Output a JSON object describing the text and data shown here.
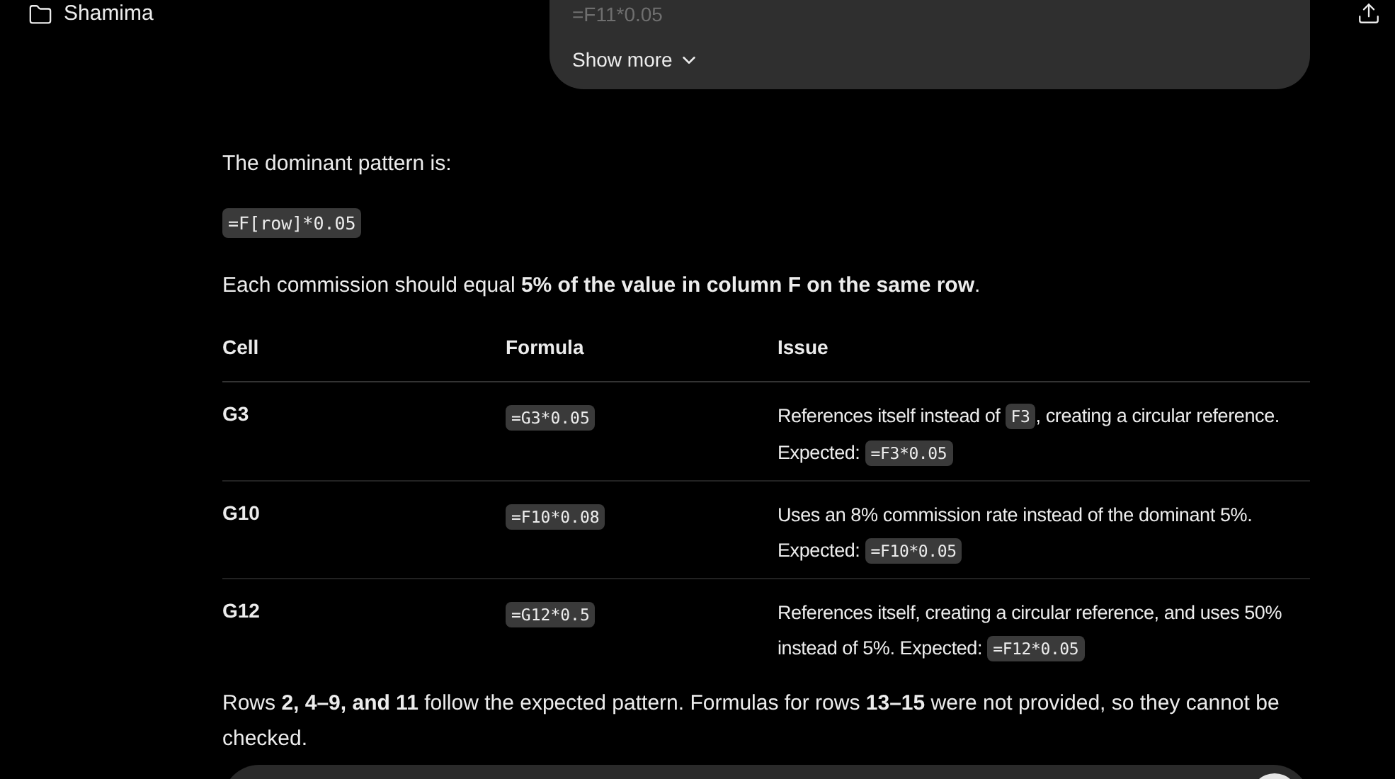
{
  "sidebar": {
    "project": "Shamima"
  },
  "user_message": {
    "preview": "=F11*0.05",
    "toggle": "Show more"
  },
  "answer": {
    "intro": "The dominant pattern is:",
    "pattern": "=F[row]*0.05",
    "explanation": "Each commission should equal **5% of the value in column F on the same row**.",
    "table": {
      "columns": [
        "Cell",
        "Formula",
        "Issue"
      ],
      "rows": [
        {
          "cell": "G3",
          "formula": "=G3*0.05",
          "issue": [
            {
              "kind": "text",
              "text": "References itself instead of "
            },
            {
              "kind": "code",
              "text": "F3"
            },
            {
              "kind": "text",
              "text": ", creating a circular reference."
            },
            {
              "kind": "break"
            },
            {
              "kind": "text",
              "text": "Expected: "
            },
            {
              "kind": "code",
              "text": "=F3*0.05"
            }
          ]
        },
        {
          "cell": "G10",
          "formula": "=F10*0.08",
          "issue": [
            {
              "kind": "text",
              "text": "Uses an 8% commission rate instead of the dominant 5%."
            },
            {
              "kind": "break"
            },
            {
              "kind": "text",
              "text": "Expected: "
            },
            {
              "kind": "code",
              "text": "=F10*0.05"
            }
          ]
        },
        {
          "cell": "G12",
          "formula": "=G12*0.5",
          "issue": [
            {
              "kind": "text",
              "text": "References itself, creating a circular reference, and uses 50% instead of 5%. Expected: "
            },
            {
              "kind": "code",
              "text": "=F12*0.05"
            }
          ]
        }
      ]
    },
    "summary": "Rows **2, 4–9, and 11** follow the expected pattern. Formulas for rows **13–15** were not provided, so they cannot be checked."
  }
}
